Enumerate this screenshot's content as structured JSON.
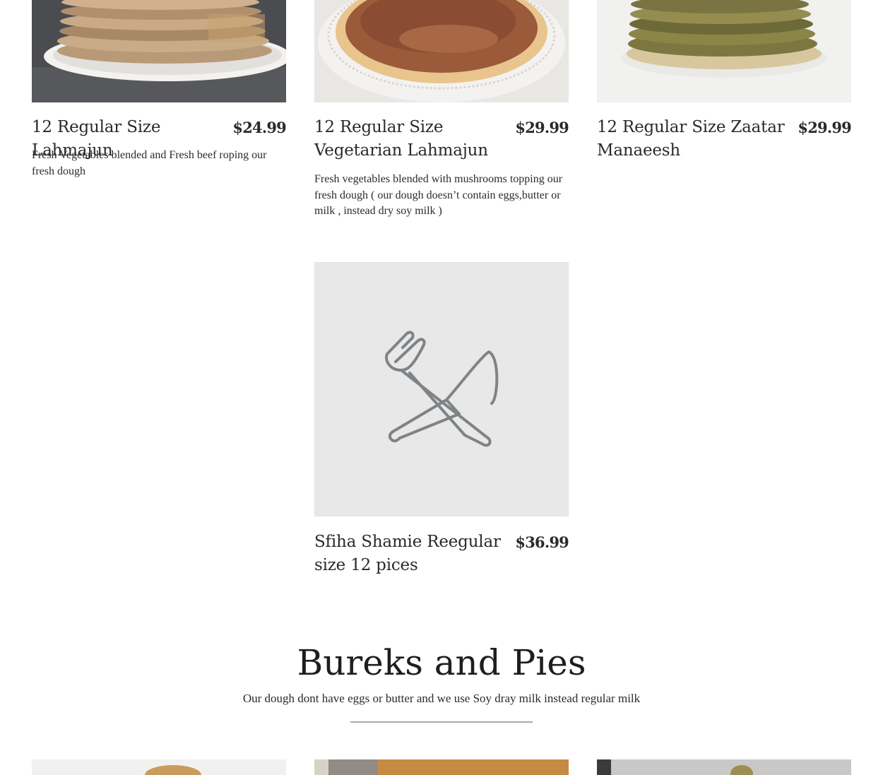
{
  "menu_items": [
    {
      "name": "12 Regular Size Lahmajun",
      "price": "$24.99",
      "description": "Fresh Vegetables blended and Fresh beef roping our fresh dough",
      "image": "photo-stack-flatbreads"
    },
    {
      "name": "12 Regular Size Vegetarian Lahmajun",
      "price": "$29.99",
      "description": "Fresh vegetables blended with mushrooms topping our fresh dough ( our dough doesn’t contain eggs,butter or milk , instead dry soy milk )",
      "image": "photo-vegetarian-lahmajun"
    },
    {
      "name": "12 Regular Size Zaatar Manaeesh",
      "price": "$29.99",
      "description": "",
      "image": "photo-zaatar-manaeesh"
    },
    {
      "name": "Sfiha Shamie Reegular size 12 pices",
      "price": "$36.99",
      "description": "",
      "image": "utensils-placeholder-icon"
    }
  ],
  "section": {
    "title": "Bureks and Pies",
    "subtitle": "Our dough dont have eggs or butter and we use Soy dray milk instead regular milk"
  },
  "colors": {
    "text": "#1f1f1f",
    "placeholder_bg": "#e8e8e8",
    "placeholder_icon": "#7f8386",
    "divider": "#a9a9a9"
  }
}
